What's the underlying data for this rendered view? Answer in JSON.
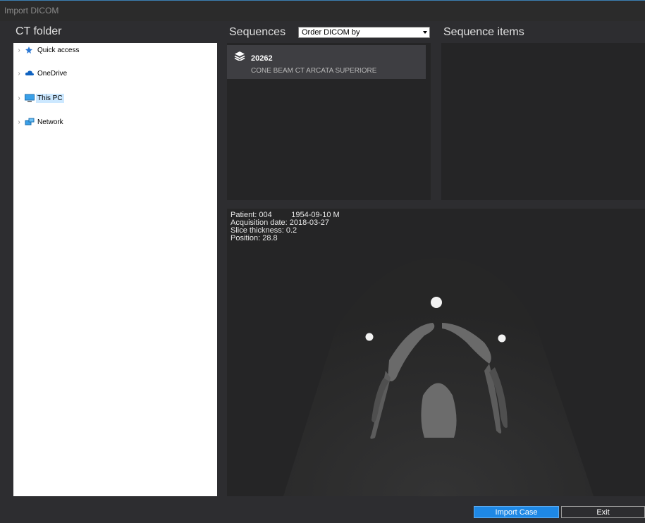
{
  "window": {
    "title": "Import DICOM"
  },
  "ct_folder": {
    "title": "CT folder",
    "tree": [
      {
        "label": "Quick access",
        "icon": "pin-icon"
      },
      {
        "label": "OneDrive",
        "icon": "cloud-icon"
      },
      {
        "label": "This PC",
        "icon": "computer-icon",
        "selected": true
      },
      {
        "label": "Network",
        "icon": "network-icon"
      }
    ]
  },
  "sequences": {
    "title": "Sequences",
    "order_select": {
      "value": "Order DICOM by"
    },
    "items": [
      {
        "number": "20262",
        "description": "CONE BEAM CT ARCATA SUPERIORE",
        "icon": "layers-icon"
      }
    ]
  },
  "sequence_items": {
    "title": "Sequence items"
  },
  "preview": {
    "patient": "Patient: 004         1954-09-10 M",
    "acquisition_date": "Acquisition date: 2018-03-27",
    "slice_thickness": "Slice thickness: 0.2",
    "position": "Position: 28.8"
  },
  "buttons": {
    "import": "Import Case",
    "exit": "Exit"
  },
  "colors": {
    "accent": "#1e88e5",
    "selection": "#cce8ff",
    "background": "#2d2d30"
  }
}
